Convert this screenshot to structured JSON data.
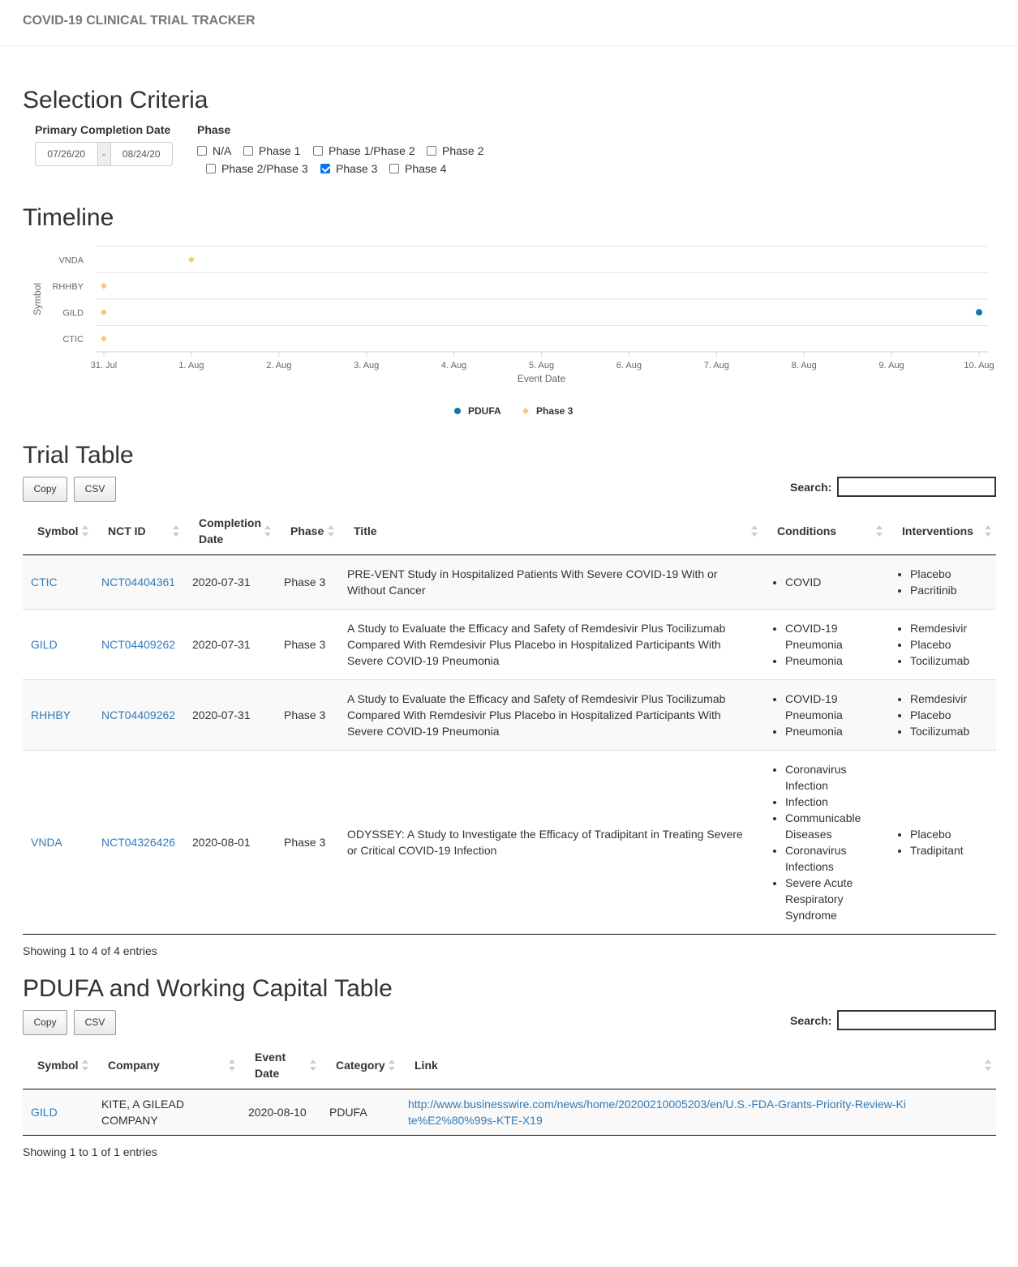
{
  "app": {
    "title": "COVID-19 CLINICAL TRIAL TRACKER"
  },
  "selection": {
    "heading": "Selection Criteria",
    "date_label": "Primary Completion Date",
    "date_start": "07/26/20",
    "date_sep": "-",
    "date_end": "08/24/20",
    "phase_label": "Phase",
    "phases": [
      {
        "label": "N/A",
        "checked": false
      },
      {
        "label": "Phase 1",
        "checked": false
      },
      {
        "label": "Phase 1/Phase 2",
        "checked": false
      },
      {
        "label": "Phase 2",
        "checked": false
      },
      {
        "label": "Phase 2/Phase 3",
        "checked": false
      },
      {
        "label": "Phase 3",
        "checked": true
      },
      {
        "label": "Phase 4",
        "checked": false
      }
    ]
  },
  "timeline": {
    "heading": "Timeline",
    "legend": [
      {
        "label": "PDUFA",
        "color": "#1577a8",
        "marker": "circle"
      },
      {
        "label": "Phase 3",
        "color": "#f7c97c",
        "marker": "diamond"
      }
    ]
  },
  "chart_data": {
    "type": "scatter",
    "xlabel": "Event Date",
    "ylabel": "Symbol",
    "categories_y": [
      "VNDA",
      "RHHBY",
      "GILD",
      "CTIC"
    ],
    "x_ticks": [
      "31. Jul",
      "1. Aug",
      "2. Aug",
      "3. Aug",
      "4. Aug",
      "5. Aug",
      "6. Aug",
      "7. Aug",
      "8. Aug",
      "9. Aug",
      "10. Aug"
    ],
    "xlim": [
      "2020-07-31",
      "2020-08-10"
    ],
    "grid": true,
    "legend_position": "bottom",
    "series": [
      {
        "name": "PDUFA",
        "color": "#1577a8",
        "marker": "circle",
        "points": [
          {
            "x": "2020-08-10",
            "y": "GILD"
          }
        ]
      },
      {
        "name": "Phase 3",
        "color": "#f7c97c",
        "marker": "diamond",
        "points": [
          {
            "x": "2020-08-01",
            "y": "VNDA"
          },
          {
            "x": "2020-07-31",
            "y": "RHHBY"
          },
          {
            "x": "2020-07-31",
            "y": "GILD"
          },
          {
            "x": "2020-07-31",
            "y": "CTIC"
          }
        ]
      }
    ]
  },
  "trial_table": {
    "heading": "Trial Table",
    "copy_label": "Copy",
    "csv_label": "CSV",
    "search_label": "Search:",
    "columns": [
      "Symbol",
      "NCT ID",
      "Completion Date",
      "Phase",
      "Title",
      "Conditions",
      "Interventions"
    ],
    "rows": [
      {
        "symbol": "CTIC",
        "nct": "NCT04404361",
        "date": "2020-07-31",
        "phase": "Phase 3",
        "title": "PRE-VENT Study in Hospitalized Patients With Severe COVID-19 With or Without Cancer",
        "conditions": [
          "COVID"
        ],
        "interventions": [
          "Placebo",
          "Pacritinib"
        ]
      },
      {
        "symbol": "GILD",
        "nct": "NCT04409262",
        "date": "2020-07-31",
        "phase": "Phase 3",
        "title": "A Study to Evaluate the Efficacy and Safety of Remdesivir Plus Tocilizumab Compared With Remdesivir Plus Placebo in Hospitalized Participants With Severe COVID-19 Pneumonia",
        "conditions": [
          "COVID-19 Pneumonia",
          "Pneumonia"
        ],
        "interventions": [
          "Remdesivir",
          "Placebo",
          "Tocilizumab"
        ]
      },
      {
        "symbol": "RHHBY",
        "nct": "NCT04409262",
        "date": "2020-07-31",
        "phase": "Phase 3",
        "title": "A Study to Evaluate the Efficacy and Safety of Remdesivir Plus Tocilizumab Compared With Remdesivir Plus Placebo in Hospitalized Participants With Severe COVID-19 Pneumonia",
        "conditions": [
          "COVID-19 Pneumonia",
          "Pneumonia"
        ],
        "interventions": [
          "Remdesivir",
          "Placebo",
          "Tocilizumab"
        ]
      },
      {
        "symbol": "VNDA",
        "nct": "NCT04326426",
        "date": "2020-08-01",
        "phase": "Phase 3",
        "title": "ODYSSEY: A Study to Investigate the Efficacy of Tradipitant in Treating Severe or Critical COVID-19 Infection",
        "conditions": [
          "Coronavirus Infection",
          "Infection",
          "Communicable Diseases",
          "Coronavirus Infections",
          "Severe Acute Respiratory Syndrome"
        ],
        "interventions": [
          "Placebo",
          "Tradipitant"
        ]
      }
    ],
    "info": "Showing 1 to 4 of 4 entries"
  },
  "pdufa_table": {
    "heading": "PDUFA and Working Capital Table",
    "copy_label": "Copy",
    "csv_label": "CSV",
    "search_label": "Search:",
    "columns": [
      "Symbol",
      "Company",
      "Event Date",
      "Category",
      "Link"
    ],
    "rows": [
      {
        "symbol": "GILD",
        "company": "KITE, A GILEAD COMPANY",
        "date": "2020-08-10",
        "category": "PDUFA",
        "link": "http://www.businesswire.com/news/home/20200210005203/en/U.S.-FDA-Grants-Priority-Review-Kite%E2%80%99s-KTE-X19"
      }
    ],
    "info": "Showing 1 to 1 of 1 entries"
  }
}
